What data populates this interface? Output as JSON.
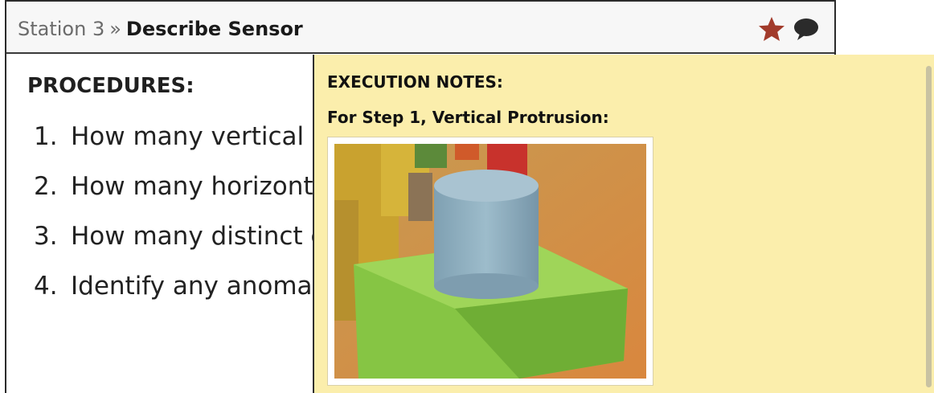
{
  "header": {
    "breadcrumb_parent": "Station 3",
    "breadcrumb_separator": "»",
    "breadcrumb_current": "Describe Sensor"
  },
  "procedures": {
    "heading": "PROCEDURES:",
    "steps": [
      {
        "num": "1.",
        "text": "How many vertical protrusions"
      },
      {
        "num": "2.",
        "text": "How many horizontal protrusions"
      },
      {
        "num": "3.",
        "text": "How many distinct colors"
      },
      {
        "num": "4.",
        "text": "Identify any anomalies"
      }
    ]
  },
  "notes": {
    "title": "EXECUTION NOTES:",
    "subtitle": "For Step 1, Vertical Protrusion:"
  },
  "colors": {
    "star": "#a23b2b",
    "notes_bg": "#fbeeac"
  }
}
